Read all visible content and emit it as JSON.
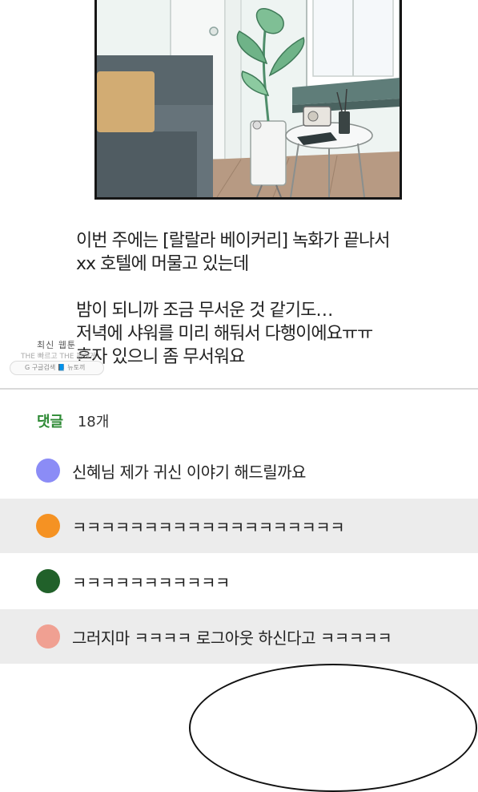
{
  "narration": {
    "lines": [
      "이번 주에는 [랄랄라 베이커리] 녹화가 끝나서",
      "xx 호텔에 머물고 있는데",
      "",
      "밤이 되니까 조금 무서운 것 같기도…",
      "저녁에 샤워를 미리 해둬서 다행이에요ㅠㅠ",
      "혼자 있으니 좀 무서워요"
    ]
  },
  "watermark": {
    "title": "최신 웹툰",
    "subtitle": "THE 빠르고 THE 편하게",
    "box_text": "G 구글검색  📘 뉴토끼"
  },
  "comments": {
    "label": "댓글",
    "count": "18개",
    "items": [
      {
        "text": "신혜님 제가 귀신 이야기 해드릴까요",
        "avatar_color": "#8b8cf6"
      },
      {
        "text": "ㅋㅋㅋㅋㅋㅋㅋㅋㅋㅋㅋㅋㅋㅋㅋㅋㅋㅋㅋ",
        "avatar_color": "#f59223"
      },
      {
        "text": "ㅋㅋㅋㅋㅋㅋㅋㅋㅋㅋㅋ",
        "avatar_color": "#21612a"
      },
      {
        "text": "그러지마 ㅋㅋㅋㅋ 로그아웃 하신다고 ㅋㅋㅋㅋㅋ",
        "avatar_color": "#f0a092"
      }
    ]
  },
  "colors": {
    "accent_green": "#2e8a35",
    "alt_row_bg": "#ececec",
    "divider": "#d9d9d9"
  }
}
